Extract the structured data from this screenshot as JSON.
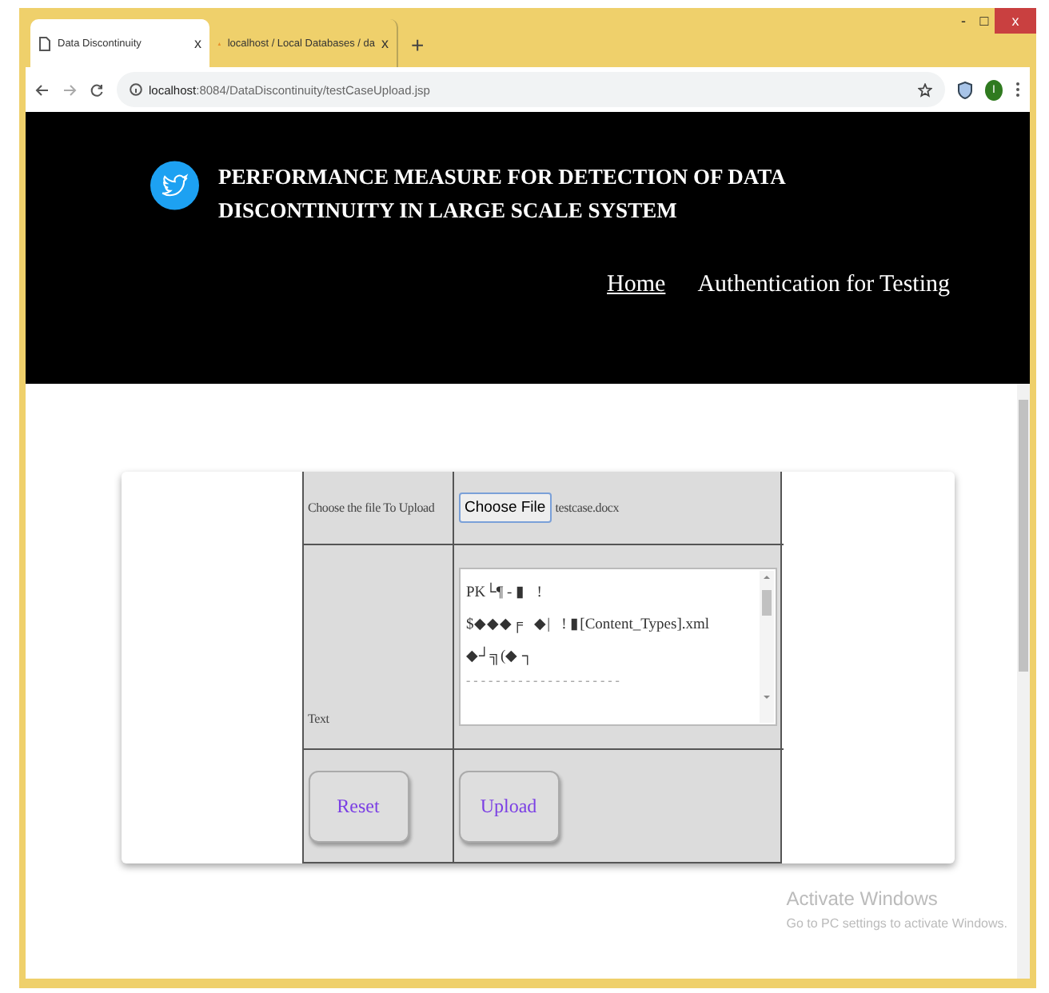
{
  "window": {
    "title_buttons": [
      "-",
      "□",
      "x"
    ]
  },
  "tabs": [
    {
      "label": "Data Discontinuity",
      "selected": true,
      "close": "x"
    },
    {
      "label": "localhost / Local Databases / da",
      "selected": false,
      "close": "x"
    }
  ],
  "new_tab": "+",
  "address": {
    "host": "localhost",
    "path": ":8084/DataDiscontinuity/testCaseUpload.jsp"
  },
  "profile": "I",
  "header": {
    "title": "PERFORMANCE MEASURE FOR DETECTION OF DATA DISCONTINUITY IN LARGE SCALE SYSTEM",
    "nav": [
      {
        "label": "Home",
        "selected": true
      },
      {
        "label": "Authentication for Testing",
        "selected": false
      }
    ]
  },
  "form": {
    "file_label": "Choose the file To Upload",
    "file_button": "Choose File",
    "file_name": "testcase.docx",
    "text_label": "Text",
    "text_lines": [
      "PK└¶ - ▮   !",
      "$◆◆◆╒   ◆|   ! ▮[Content_Types].xml",
      "◆┘╗(◆ ┐",
      "- - - - - - - - - - - - - - - - - - - - -"
    ],
    "buttons": [
      "Reset",
      "Upload"
    ]
  },
  "activation": {
    "title": "Activate Windows",
    "hint": "Go to PC settings to activate Windows."
  }
}
